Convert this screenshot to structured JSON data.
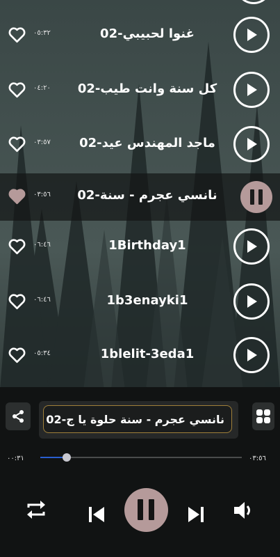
{
  "colors": {
    "accent_pause": "#b59a9a",
    "progress": "#2a5fd0",
    "panel": "#111313",
    "border_gold": "#a0803a"
  },
  "tracks": [
    {
      "title": "02-غنوا لحبيبي",
      "duration": "٠٥:٣٢",
      "state": "play"
    },
    {
      "title": "02-كل سنة وانت طيب",
      "duration": "٠٤:٢٠",
      "state": "play"
    },
    {
      "title": "02-ماجد المهندس  عيد",
      "duration": "٠٣:٥٧",
      "state": "play"
    },
    {
      "title": "02-نانسي عجرم - سنة",
      "duration": "٠٣:٥٦",
      "state": "playing"
    },
    {
      "title": "1Birthday1",
      "duration": "٠٦:٤٦",
      "state": "play"
    },
    {
      "title": "1b3enayki1",
      "duration": "٠٦:٤٦",
      "state": "play"
    },
    {
      "title": "1blelit-3eda1",
      "duration": "٠٥:٣٤",
      "state": "play"
    }
  ],
  "player": {
    "now_playing": "02-نانسي عجرم - سنة حلوة يا ج",
    "current_time": "٠٠:٣١",
    "total_time": "٠٣:٥٦",
    "progress_fraction": 0.13
  },
  "icons": {
    "heart": "heart-icon",
    "play": "play-icon",
    "pause": "pause-icon",
    "share": "share-icon",
    "grid": "grid-icon",
    "repeat": "repeat-icon",
    "previous": "skip-previous-icon",
    "next": "skip-next-icon",
    "volume": "volume-icon"
  }
}
